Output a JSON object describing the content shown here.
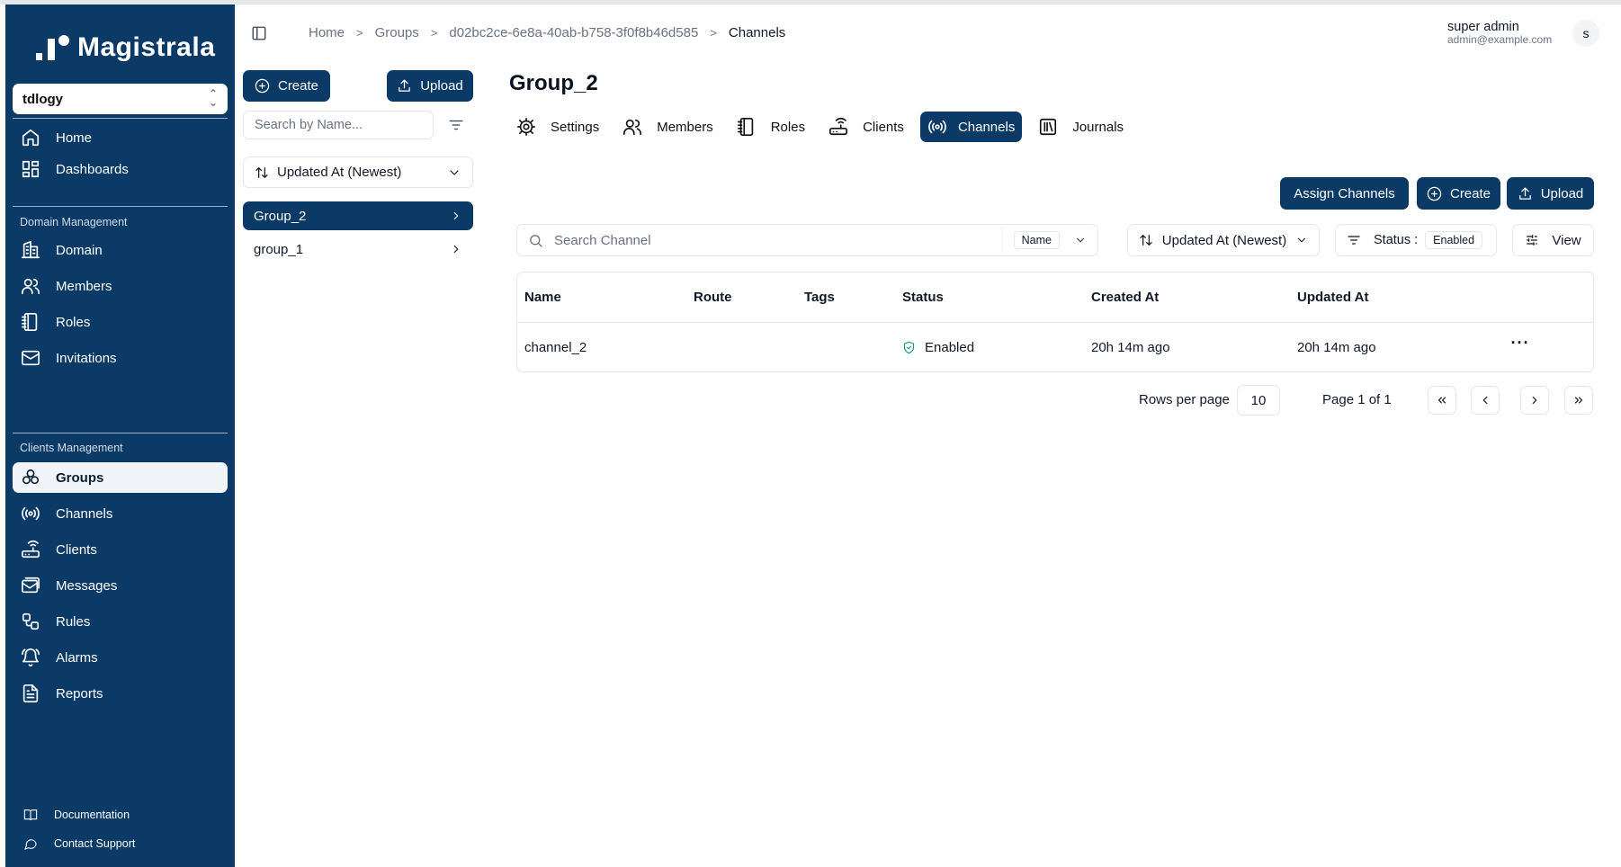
{
  "sidebar": {
    "brand": "Magistrala",
    "domain_selector": "tdlogy",
    "top_items": [
      {
        "label": "Home",
        "icon": "home-icon"
      },
      {
        "label": "Dashboards",
        "icon": "dashboard-icon"
      }
    ],
    "domain_section_title": "Domain Management",
    "domain_items": [
      {
        "label": "Domain",
        "icon": "domain-icon"
      },
      {
        "label": "Members",
        "icon": "users-icon"
      },
      {
        "label": "Roles",
        "icon": "notebook-icon"
      },
      {
        "label": "Invitations",
        "icon": "mail-icon"
      }
    ],
    "clients_section_title": "Clients Management",
    "clients_items": [
      {
        "label": "Groups",
        "icon": "groups-icon",
        "active": true
      },
      {
        "label": "Channels",
        "icon": "radio-icon"
      },
      {
        "label": "Clients",
        "icon": "router-icon"
      },
      {
        "label": "Messages",
        "icon": "messages-icon"
      },
      {
        "label": "Rules",
        "icon": "workflow-icon"
      },
      {
        "label": "Alarms",
        "icon": "bell-icon"
      },
      {
        "label": "Reports",
        "icon": "report-icon"
      }
    ],
    "footer": {
      "documentation": "Documentation",
      "support": "Contact Support"
    }
  },
  "header": {
    "breadcrumb": [
      "Home",
      "Groups",
      "d02bc2ce-6e8a-40ab-b758-3f0f8b46d585",
      "Channels"
    ],
    "user_name": "super admin",
    "user_email": "admin@example.com",
    "avatar_initial": "s"
  },
  "groups_panel": {
    "create_label": "Create",
    "upload_label": "Upload",
    "search_placeholder": "Search by Name...",
    "sort_label": "Updated At (Newest)",
    "items": [
      {
        "name": "Group_2",
        "active": true
      },
      {
        "name": "group_1",
        "active": false
      }
    ]
  },
  "main": {
    "title": "Group_2",
    "tabs": [
      {
        "label": "Settings",
        "icon": "settings-icon"
      },
      {
        "label": "Members",
        "icon": "users-icon"
      },
      {
        "label": "Roles",
        "icon": "notebook-icon"
      },
      {
        "label": "Clients",
        "icon": "router-icon"
      },
      {
        "label": "Channels",
        "icon": "radio-icon",
        "active": true
      },
      {
        "label": "Journals",
        "icon": "library-icon"
      }
    ],
    "actions": {
      "assign": "Assign Channels",
      "create": "Create",
      "upload": "Upload"
    },
    "search_placeholder": "Search Channel",
    "search_field": "Name",
    "sort_label": "Updated At (Newest)",
    "status_label": "Status :",
    "status_value": "Enabled",
    "view_label": "View",
    "table": {
      "columns": [
        "Name",
        "Route",
        "Tags",
        "Status",
        "Created At",
        "Updated At"
      ],
      "rows": [
        {
          "name": "channel_2",
          "route": "",
          "tags": "",
          "status": "Enabled",
          "created": "20h 14m ago",
          "updated": "20h 14m ago",
          "more": "···"
        }
      ]
    },
    "pagination": {
      "rows_label": "Rows per page",
      "rows_value": "10",
      "page_label": "Page 1 of 1"
    }
  },
  "colors": {
    "primary": "#0b3a66",
    "status_enabled": "#0e9488"
  }
}
